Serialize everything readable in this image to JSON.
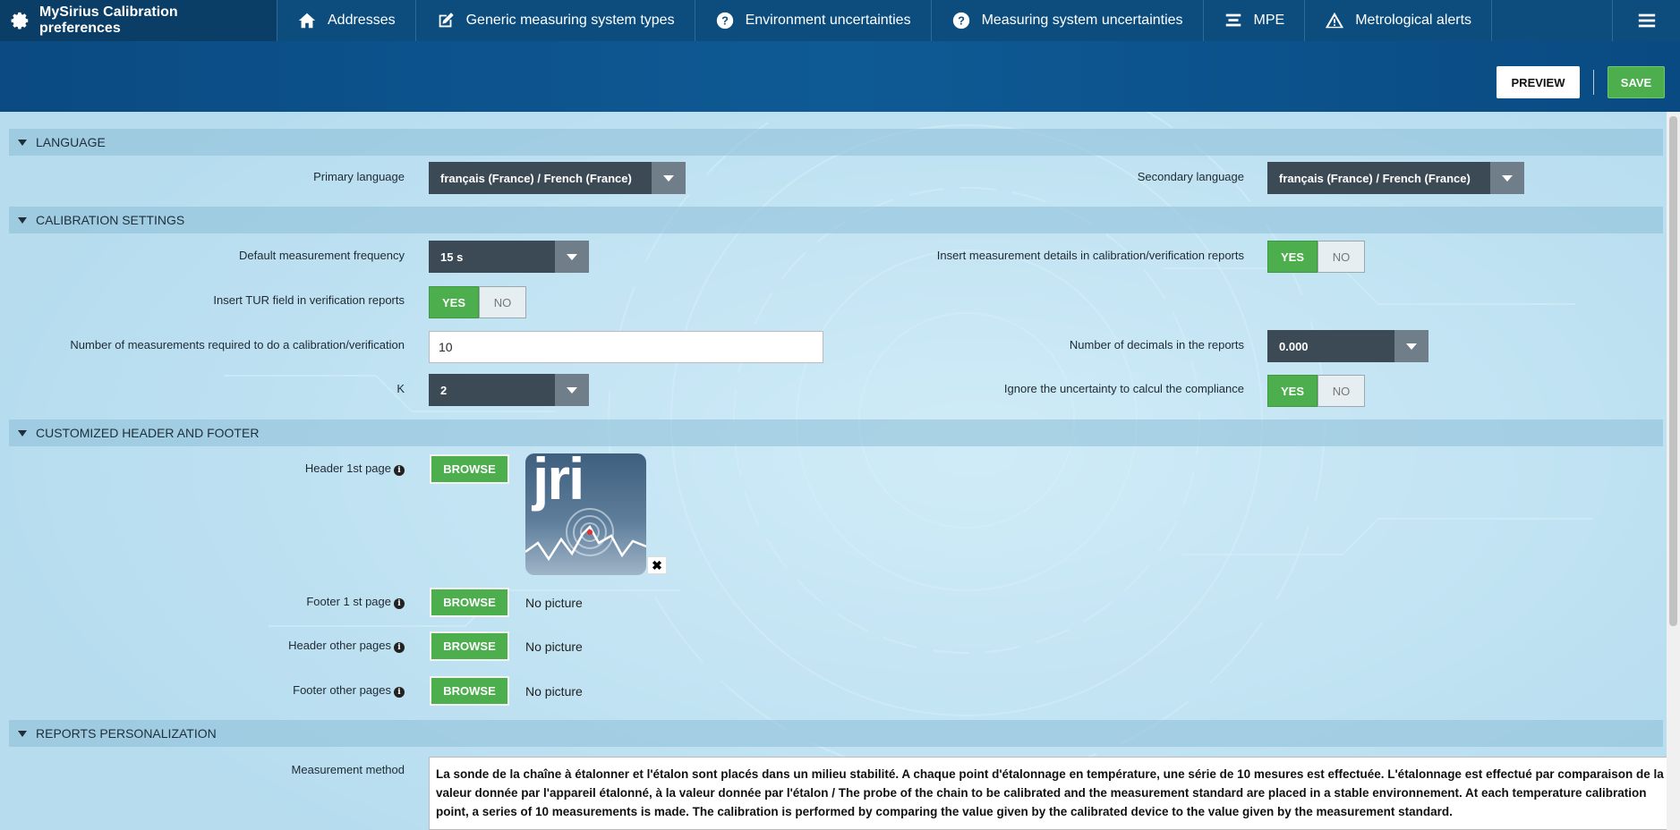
{
  "topnav": {
    "brand": "MySirius Calibration preferences",
    "items": [
      {
        "label": "Addresses",
        "icon": "home-icon"
      },
      {
        "label": "Generic measuring system types",
        "icon": "edit-icon"
      },
      {
        "label": "Environment uncertainties",
        "icon": "question-icon"
      },
      {
        "label": "Measuring system uncertainties",
        "icon": "question-icon"
      },
      {
        "label": "MPE",
        "icon": "stack-icon"
      },
      {
        "label": "Metrological alerts",
        "icon": "warning-icon"
      }
    ],
    "menu_icon": "hamburger-icon"
  },
  "actions": {
    "preview": "PREVIEW",
    "save": "SAVE"
  },
  "language": {
    "title": "LANGUAGE",
    "primary_label": "Primary language",
    "primary_value": "français (France) / French (France)",
    "secondary_label": "Secondary language",
    "secondary_value": "français (France) / French (France)"
  },
  "calibration": {
    "title": "CALIBRATION SETTINGS",
    "freq_label": "Default measurement frequency",
    "freq_value": "15 s",
    "insert_details_label": "Insert measurement details in calibration/verification reports",
    "tur_label": "Insert TUR field in verification reports",
    "num_meas_label": "Number of measurements required to do a calibration/verification",
    "num_meas_value": "10",
    "decimals_label": "Number of decimals in the reports",
    "decimals_value": "0.000",
    "k_label": "K",
    "k_value": "2",
    "ignore_label": "Ignore the uncertainty to calcul the compliance",
    "yes": "YES",
    "no": "NO"
  },
  "header_footer": {
    "title": "CUSTOMIZED HEADER AND FOOTER",
    "header_first_label": "Header 1st page",
    "footer_first_label": "Footer 1 st page",
    "header_other_label": "Header other pages",
    "footer_other_label": "Footer other pages",
    "browse": "BROWSE",
    "no_picture": "No picture",
    "info": "i",
    "remove": "✖",
    "logo_text": "jri"
  },
  "reports": {
    "title": "REPORTS PERSONALIZATION",
    "method_label": "Measurement method",
    "method_text": "La sonde de la chaîne à étalonner et l'étalon sont placés dans un milieu stabilité. A chaque point d'étalonnage en température, une série de 10 mesures est effectuée. L'étalonnage est effectué par comparaison de la valeur donnée par l'appareil étalonné, à la valeur donnée par l'étalon / The probe of the chain to be calibrated and the measurement standard are placed in a stable environnement. At each temperature calibration point, a series of 10 measurements is made. The calibration is performed by comparing the value given by the calibrated device to the value given by the measurement standard."
  },
  "colors": {
    "nav": "#0c4d7e",
    "accent_green": "#4cae4c",
    "select_dark": "#3c4a55"
  }
}
